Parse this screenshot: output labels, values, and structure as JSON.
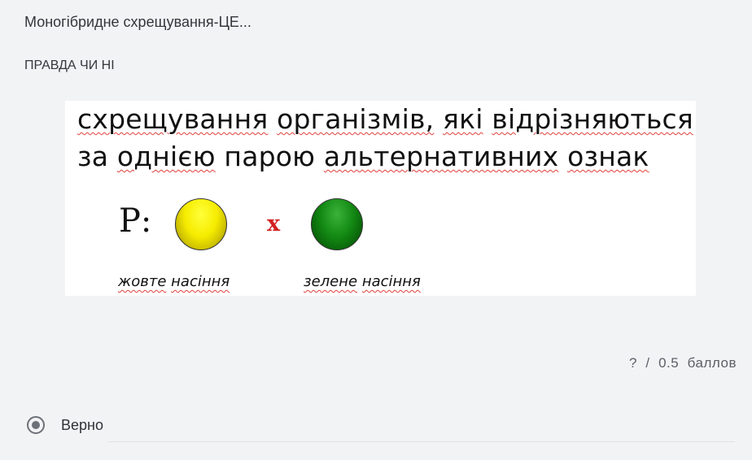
{
  "question": {
    "title": "Моногібридне схрещування-ЦЕ...",
    "type": "ПРАВДА ЧИ НІ"
  },
  "image": {
    "definition_line1": [
      "схрещування",
      "організмів,",
      "які",
      "відрізняються"
    ],
    "definition_line2": [
      "за",
      "однією",
      "парою",
      "альтернативних",
      "ознак"
    ],
    "p_label": "Р:",
    "cross_symbol": "х",
    "seed1_words": [
      "жовте",
      "насіння"
    ],
    "seed2_words": [
      "зелене",
      "насіння"
    ],
    "seed1_color": "#f6ec00",
    "seed2_color": "#138a13"
  },
  "score": {
    "earned": "?",
    "separator": "/",
    "max": "0.5",
    "unit": "баллов"
  },
  "answer": {
    "label": "Верно",
    "selected": true
  }
}
